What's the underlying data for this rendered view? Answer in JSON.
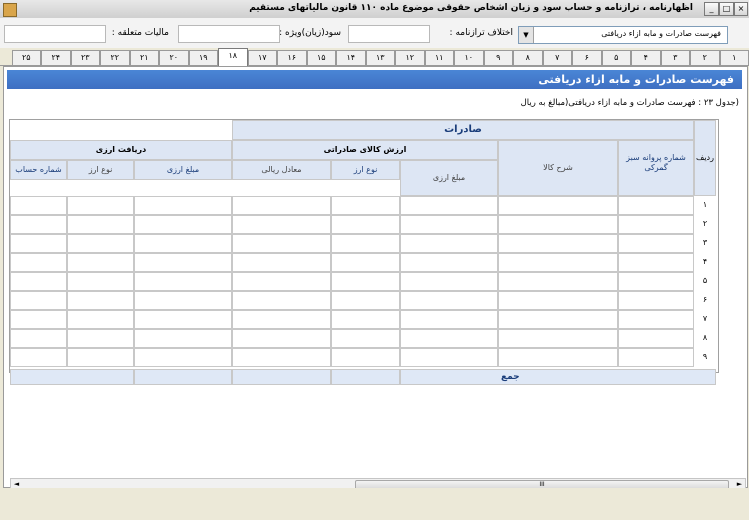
{
  "window": {
    "title": "اظهارنامه ، ترازنامه و حساب سود و زیان اشخاص حقوقی موضوع ماده ۱۱۰ قانون مالیاتهای مستقیم",
    "btn_min": "_",
    "btn_max": "□",
    "btn_close": "×"
  },
  "topbar": {
    "dropdown_value": "فهرست صادرات و مابه ازاء دریافتی",
    "arrow_glyph": "▼",
    "ikhtelaf_label": "اختلاف ترازنامه :",
    "sood_label": "سود(زیان)ویژه :",
    "maliyat_label": "مالیات متعلقه :"
  },
  "tabs": [
    "۱",
    "۲",
    "۳",
    "۴",
    "۵",
    "۶",
    "۷",
    "۸",
    "۹",
    "۱۰",
    "۱۱",
    "۱۲",
    "۱۳",
    "۱۴",
    "۱۵",
    "۱۶",
    "۱۷",
    "۱۸",
    "۱۹",
    "۲۰",
    "۲۱",
    "۲۲",
    "۲۳",
    "۲۴",
    "۲۵"
  ],
  "active_tab": "۱۸",
  "panel": {
    "header": "فهرست صادرات و مابه ازاء دریافتی",
    "caption": "(جدول ۲۳ : فهرست صادرات و مابه ازاء دریافتی(مبالغ به ریال"
  },
  "table": {
    "col_radif": "ردیف",
    "group_sadirat": "صادرات",
    "group_arzesh": "ارزش کالای صادراتی",
    "group_daryaft": "دریافت ارزی",
    "col_parvaneh": "شماره پروانه سبز گمرکی",
    "col_sharh": "شرح کالا",
    "col_mablagh_arzi": "مبلغ ارزی",
    "col_no_arz": "نوع ارز",
    "col_moadel_riali": "معادل ریالی",
    "col_mablagh_arzi2": "مبلغ ارزی",
    "col_no_arz2": "نوع ارز",
    "col_hesab": "شماره حساب",
    "rows": [
      "۱",
      "۲",
      "۳",
      "۴",
      "۵",
      "۶",
      "۷",
      "۸",
      "۹"
    ],
    "total_label": "جمع"
  },
  "scrollbar": {
    "left_arrow": "◄",
    "right_arrow": "►",
    "grip": "III"
  }
}
